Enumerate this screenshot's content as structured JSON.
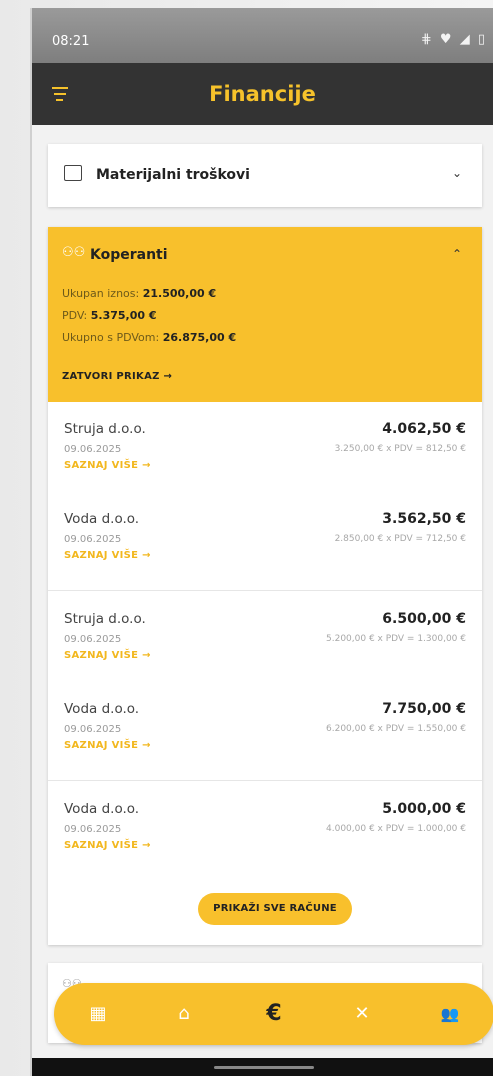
{
  "status": {
    "time": "08:21",
    "icons": "⋕ ♥ ◢ ▯"
  },
  "appbar": {
    "title": "Financije"
  },
  "sections": [
    {
      "label": "Materijalni troškovi",
      "expanded": false
    },
    {
      "label": "Koperanti",
      "expanded": true,
      "summary": {
        "total_label": "Ukupan iznos:",
        "total_value": "21.500,00 €",
        "vat_label": "PDV:",
        "vat_value": "5.375,00 €",
        "grand_label": "Ukupno s PDVom:",
        "grand_value": "26.875,00 €"
      },
      "close_label": "ZATVORI PRIKAZ →",
      "rows": [
        {
          "name": "Struja d.o.o.",
          "amount": "4.062,50 €",
          "date": "09.06.2025",
          "calc": "3.250,00 € x PDV = 812,50 €",
          "more": "SAZNAJ VIŠE →"
        },
        {
          "name": "Voda d.o.o.",
          "amount": "3.562,50 €",
          "date": "09.06.2025",
          "calc": "2.850,00 € x PDV = 712,50 €",
          "more": "SAZNAJ VIŠE →"
        },
        {
          "name": "Struja d.o.o.",
          "amount": "6.500,00 €",
          "date": "09.06.2025",
          "calc": "5.200,00 € x PDV = 1.300,00 €",
          "more": "SAZNAJ VIŠE →"
        },
        {
          "name": "Voda d.o.o.",
          "amount": "7.750,00 €",
          "date": "09.06.2025",
          "calc": "6.200,00 € x PDV = 1.550,00 €",
          "more": "SAZNAJ VIŠE →"
        },
        {
          "name": "Voda d.o.o.",
          "amount": "5.000,00 €",
          "date": "09.06.2025",
          "calc": "4.000,00 € x PDV = 1.000,00 €",
          "more": "SAZNAJ VIŠE →"
        }
      ],
      "show_all_label": "PRIKAŽI SVE RAČUNE"
    }
  ],
  "nav": {
    "items": [
      {
        "icon": "dashboard-icon",
        "glyph": "▦"
      },
      {
        "icon": "home-icon",
        "glyph": "⌂"
      },
      {
        "icon": "euro-icon",
        "glyph": "€"
      },
      {
        "icon": "tools-icon",
        "glyph": "✕"
      },
      {
        "icon": "people-icon",
        "glyph": "👥"
      }
    ],
    "active_index": 2
  },
  "colors": {
    "accent": "#f8c02c",
    "appbar": "#333333"
  }
}
